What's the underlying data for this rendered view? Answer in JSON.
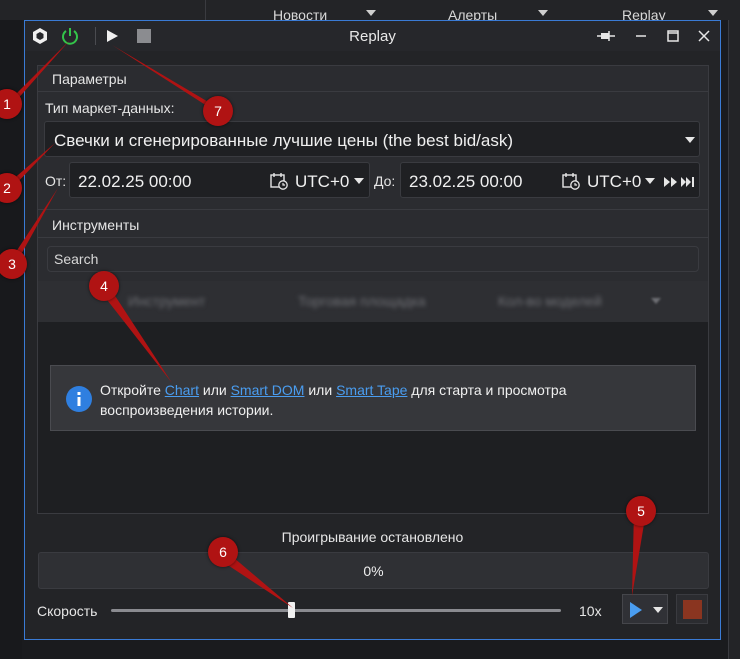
{
  "background": {
    "menu": [
      {
        "label": "Новости"
      },
      {
        "label": "Алерты"
      },
      {
        "label": "Replay"
      }
    ]
  },
  "window": {
    "title": "Replay"
  },
  "parameters": {
    "section_title": "Параметры",
    "market_data_label": "Тип маркет-данных:",
    "market_data_value": "Свечки и сгенерированные лучшие цены (the best bid/ask)",
    "from_label": "От:",
    "from_value": "22.02.25 00:00",
    "from_tz": "UTC+0",
    "to_label": "До:",
    "to_value": "23.02.25 00:00",
    "to_tz": "UTC+0"
  },
  "instruments": {
    "section_title": "Инструменты",
    "search_placeholder": "Search",
    "columns": [
      "Инструмент",
      "Торговая площадка",
      "Кол-во моделей"
    ],
    "info": {
      "t1": "Откройте ",
      "link_chart": "Chart",
      "t2": " или ",
      "link_dom": "Smart DOM",
      "t3": " или ",
      "link_tape": "Smart Tape",
      "t4": " для старта и просмотра воспроизведения истории."
    }
  },
  "playback": {
    "status": "Проигрывание остановлено",
    "progress_text": "0%",
    "progress_value": 0,
    "speed_label": "Скорость",
    "speed_value": "10x",
    "speed_position": 0.4
  },
  "annotations": [
    {
      "label": "1"
    },
    {
      "label": "2"
    },
    {
      "label": "3"
    },
    {
      "label": "4"
    },
    {
      "label": "5"
    },
    {
      "label": "6"
    },
    {
      "label": "7"
    }
  ],
  "colors": {
    "accent": "#3a7bd5",
    "power_icon": "#33c44a",
    "link": "#4a9df0",
    "info_icon": "#2f7fe0",
    "marker": "#b01313",
    "stop_square": "#8a3520"
  }
}
